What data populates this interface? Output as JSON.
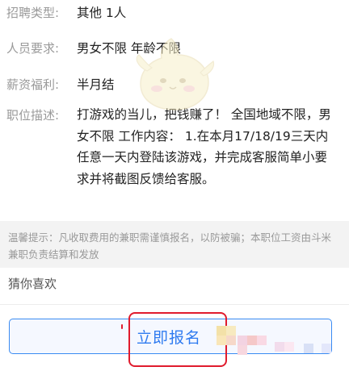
{
  "job_details": {
    "type": {
      "label": "招聘类型:",
      "value": "其他 1人"
    },
    "requirements": {
      "label": "人员要求:",
      "value": "男女不限 年龄不限"
    },
    "benefits": {
      "label": "薪资福利:",
      "value": "半月结"
    },
    "description": {
      "label": "职位描述:",
      "value": "打游戏的当儿，把钱赚了！ 全国地域不限，男女不限 工作内容： 1.在本月17/18/19三天内任意一天内登陆该游戏，并完成客服简单小要求并将截图反馈给客服。"
    }
  },
  "tip": {
    "text": "温馨提示：凡收取费用的兼职需谨慎报名，以防被骗；本职位工资由斗米兼职负责结算和发放"
  },
  "guess_section": {
    "title": "猜你喜欢"
  },
  "apply_button": {
    "label": "立即报名"
  },
  "colors": {
    "accent": "#3a8bf2",
    "annotation": "#e01b2d"
  }
}
